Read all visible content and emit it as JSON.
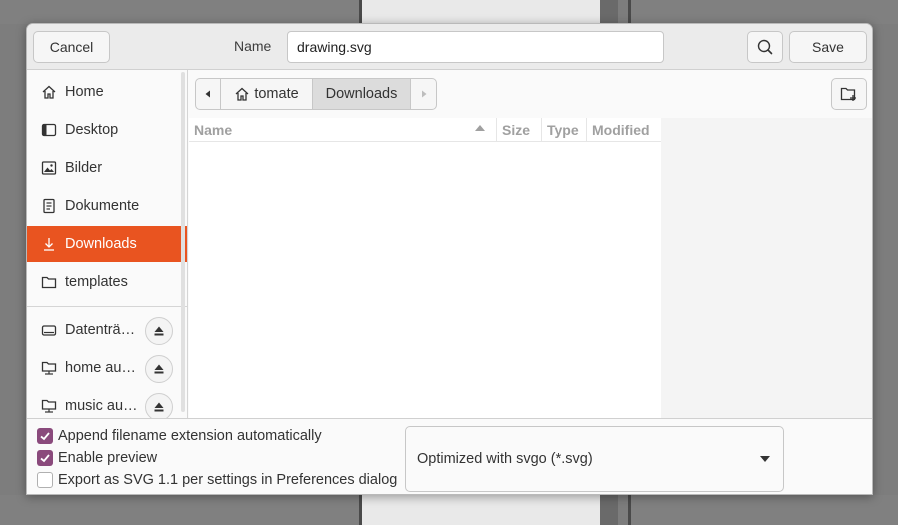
{
  "header": {
    "cancel_label": "Cancel",
    "name_label": "Name",
    "filename_value": "drawing.svg",
    "save_label": "Save",
    "search_icon": "search-icon"
  },
  "sidebar": {
    "items": [
      {
        "label": "Home",
        "icon": "home-icon"
      },
      {
        "label": "Desktop",
        "icon": "desktop-icon"
      },
      {
        "label": "Bilder",
        "icon": "pictures-icon"
      },
      {
        "label": "Dokumente",
        "icon": "documents-icon"
      },
      {
        "label": "Downloads",
        "icon": "downloads-icon",
        "active": true
      },
      {
        "label": "templates",
        "icon": "folder-icon"
      }
    ],
    "devices": [
      {
        "label": "Datenträ…",
        "icon": "drive-icon"
      },
      {
        "label": "home au…",
        "icon": "network-folder-icon"
      },
      {
        "label": "music au…",
        "icon": "network-folder-icon"
      }
    ],
    "active_color": "#e95420"
  },
  "pathbar": {
    "home_label": "tomate",
    "current_label": "Downloads"
  },
  "columns": {
    "name": "Name",
    "size": "Size",
    "type": "Type",
    "modified": "Modified"
  },
  "options": {
    "append_extension": {
      "label": "Append filename extension automatically",
      "checked": true
    },
    "enable_preview": {
      "label": "Enable preview",
      "checked": true
    },
    "export_svg11": {
      "label": "Export as SVG 1.1 per settings in Preferences dialog",
      "checked": false
    },
    "checkbox_color": "#8a4a7c"
  },
  "filetype": {
    "selected": "Optimized with svgo (*.svg)"
  }
}
